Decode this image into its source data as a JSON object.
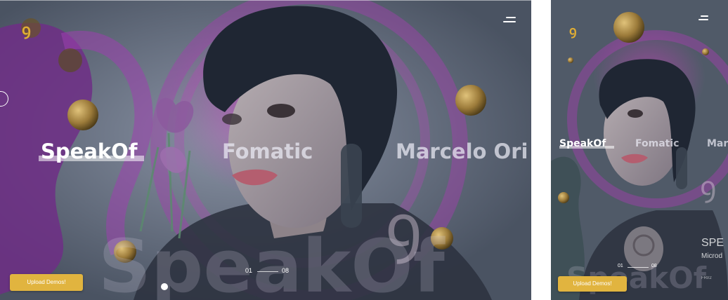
{
  "desktop": {
    "logo": "ꝯ",
    "artist_names": [
      "SpeakOf",
      "Fomatic",
      "Marcelo Ori"
    ],
    "active_index": 0,
    "background_word": "SpeakOf",
    "pager": {
      "current": "01",
      "total": "08"
    },
    "upload_button": "Upload Demos!",
    "menu_icon": "hamburger-menu-icon"
  },
  "mobile": {
    "logo": "ꝯ",
    "artist_names": [
      "SpeakOf",
      "Fomatic",
      "Mar"
    ],
    "active_index": 0,
    "background_word": "SpeakOf",
    "pager": {
      "current": "01",
      "total": "08"
    },
    "upload_button": "Upload Demos!",
    "side_title": "SPE",
    "side_subtitle": "Microd",
    "side_small": "FRI/2",
    "menu_icon": "hamburger-menu-icon"
  },
  "colors": {
    "accent_gold": "#e1b43f",
    "background_slate": "#4e5866",
    "magenta": "#a53fb0"
  }
}
